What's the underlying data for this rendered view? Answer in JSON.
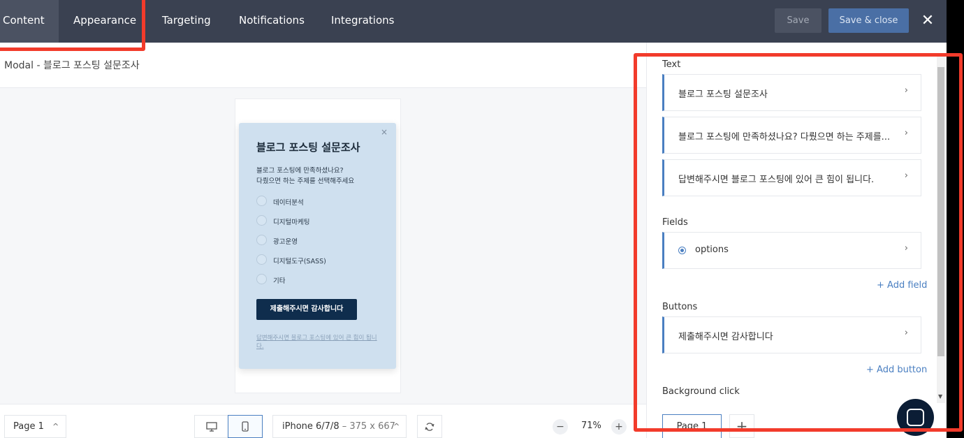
{
  "topbar": {
    "tabs": [
      "Content",
      "Appearance",
      "Targeting",
      "Notifications",
      "Integrations"
    ],
    "save_label": "Save",
    "save_close_label": "Save & close",
    "close_glyph": "✕"
  },
  "editor": {
    "title": "Modal - 블로그 포스팅 설문조사"
  },
  "preview": {
    "close_glyph": "×",
    "title": "블로그 포스팅 설문조사",
    "desc_line1": "블로그 포스팅에 만족하셨나요?",
    "desc_line2": "다뤘으면 하는 주제를 선택해주세요",
    "options": [
      "데이터분석",
      "디지털마케팅",
      "광고운영",
      "디지털도구(SASS)",
      "기타"
    ],
    "submit_label": "제출해주시면 감사합니다",
    "footer_text": "답변해주시면 블로그 포스팅에 있어 큰 힘이 됩니다."
  },
  "bottombar": {
    "page_label": "Page 1",
    "device_label": "iPhone 6/7/8",
    "device_dims": " – 375 x 667",
    "zoom": "71%",
    "minus_glyph": "−",
    "plus_glyph": "+"
  },
  "panel": {
    "text_heading": "Text",
    "text_items": [
      "블로그 포스팅 설문조사",
      "블로그 포스팅에 만족하셨나요? 다뤘으면 하는 주제를...",
      "답변해주시면 블로그 포스팅에 있어 큰 힘이 됩니다."
    ],
    "fields_heading": "Fields",
    "field_item": "options",
    "add_field": "+ Add field",
    "buttons_heading": "Buttons",
    "button_item": "제출해주시면 감사합니다",
    "add_button": "+ Add button",
    "background_heading": "Background click",
    "page_tab": "Page 1",
    "add_page_glyph": "+"
  },
  "icons": {
    "desktop": "monitor-icon",
    "mobile": "phone-icon",
    "rotate": "rotate-icon",
    "chevron": "chevron-right-icon",
    "chat": "chat-icon"
  },
  "colors": {
    "topbar": "#3a4151",
    "accent": "#4a7fc1",
    "preview_bg": "#cfe0ef",
    "submit_bg": "#0f2d4d",
    "annotation": "#f23b2b"
  }
}
